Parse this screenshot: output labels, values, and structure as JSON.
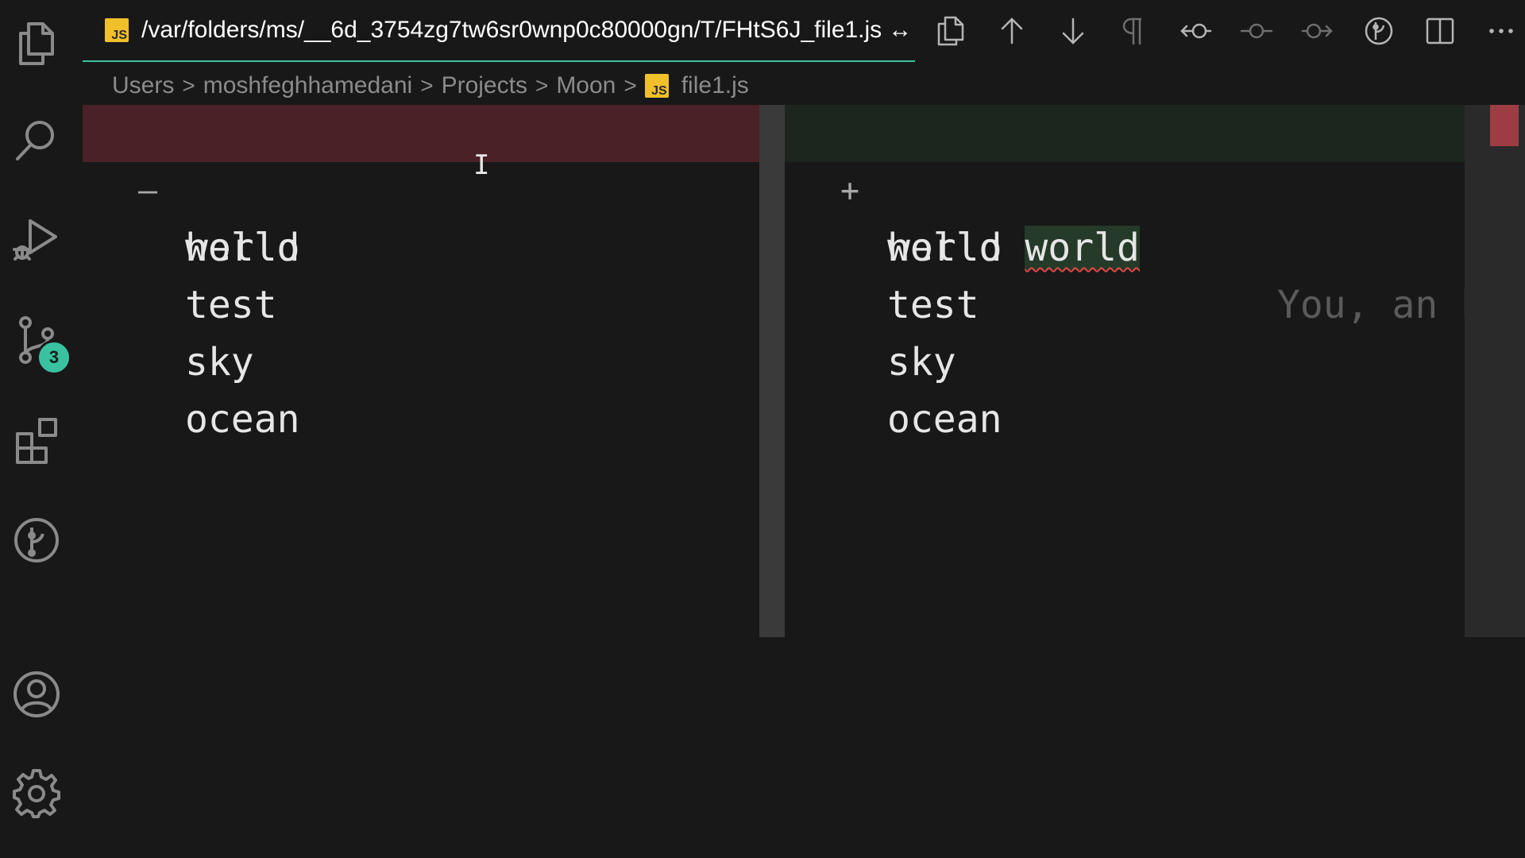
{
  "activity_bar": {
    "items": [
      {
        "name": "explorer",
        "icon": "files-icon"
      },
      {
        "name": "search",
        "icon": "search-icon"
      },
      {
        "name": "run-and-debug",
        "icon": "run-debug-icon"
      },
      {
        "name": "source-control",
        "icon": "source-control-icon",
        "badge": "3"
      },
      {
        "name": "extensions",
        "icon": "extensions-icon"
      },
      {
        "name": "git-graph",
        "icon": "git-graph-icon"
      }
    ],
    "bottom": [
      {
        "name": "accounts",
        "icon": "account-icon"
      },
      {
        "name": "manage",
        "icon": "gear-icon"
      }
    ],
    "badge_color": "#3ac2a0"
  },
  "tab": {
    "file_type": "JS",
    "title": "/var/folders/ms/__6d_3754zg7tw6sr0wnp0c80000gn/T/FHtS6J_file1.js",
    "compare_symbol": "↔"
  },
  "toolbar": [
    {
      "name": "open-file",
      "icon": "open-file-icon"
    },
    {
      "name": "previous-change",
      "icon": "arrow-up-icon"
    },
    {
      "name": "next-change",
      "icon": "arrow-down-icon"
    },
    {
      "name": "show-whitespace",
      "icon": "pilcrow-icon"
    },
    {
      "name": "previous-commit",
      "icon": "commit-previous-icon"
    },
    {
      "name": "commit",
      "icon": "commit-icon"
    },
    {
      "name": "next-commit",
      "icon": "commit-next-icon"
    },
    {
      "name": "gitlens",
      "icon": "gitlens-icon"
    },
    {
      "name": "split-editor",
      "icon": "split-editor-icon"
    },
    {
      "name": "more-actions",
      "icon": "ellipsis-icon"
    }
  ],
  "breadcrumb": {
    "parts": [
      "Users",
      "moshfeghhamedani",
      "Projects",
      "Moon"
    ],
    "file_type": "JS",
    "file": "file1.js",
    "separator": ">"
  },
  "diff": {
    "left": {
      "removed_marker": "—",
      "lines": [
        "hello",
        "world",
        "test",
        "sky",
        "ocean"
      ]
    },
    "right": {
      "added_marker": "+",
      "first_line_base": "hello",
      "first_line_added": "world",
      "ghost_text": "You, an h",
      "lines": [
        "world",
        "test",
        "sky",
        "ocean"
      ]
    },
    "colors": {
      "removed_bg": "#4a2126",
      "added_bg": "#1d261e",
      "accent": "#3ac2a0"
    }
  }
}
